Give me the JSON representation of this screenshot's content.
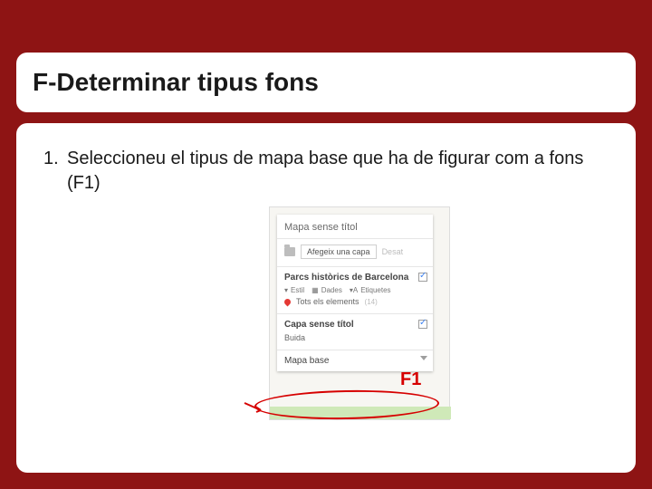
{
  "slide": {
    "title": "F-Determinar tipus fons",
    "step_number": "1.",
    "step_text": "Seleccioneu el tipus de mapa base que ha de figurar com a fons (F1)"
  },
  "panel": {
    "map_title": "Mapa sense títol",
    "add_layer": "Afegeix una capa",
    "share": "Desat",
    "layer1": {
      "name": "Parcs històrics de Barcelona",
      "style_label": "Estil",
      "data_label": "Dades",
      "labels_label": "Etiquetes",
      "all_elements": "Tots els elements",
      "count": "(14)"
    },
    "layer2": {
      "name": "Capa sense títol",
      "empty": "Buida"
    },
    "base_map": "Mapa base"
  },
  "annotation": {
    "f1": "F1"
  }
}
